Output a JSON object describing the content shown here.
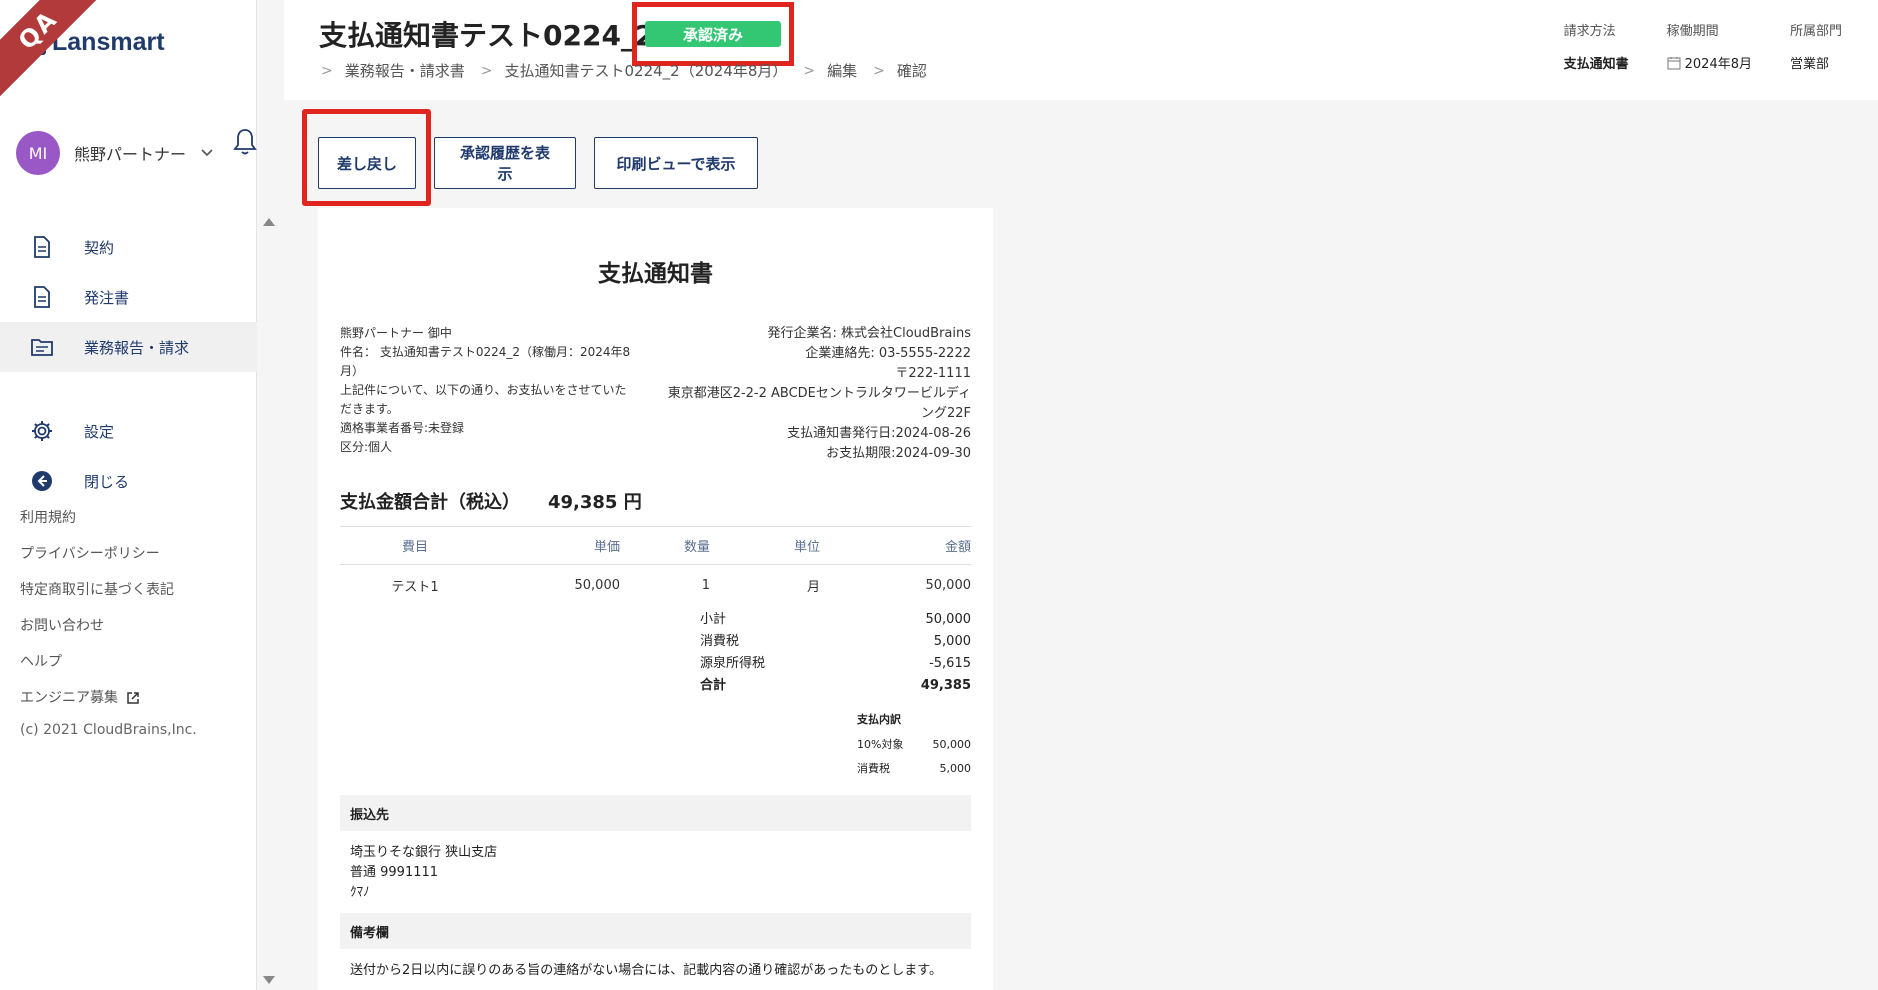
{
  "ribbon": "QA",
  "logo": {
    "text": "Lansmart"
  },
  "user": {
    "initials": "MI",
    "name": "熊野パートナー",
    "avatar_color": "#9a57c6"
  },
  "nav": {
    "contract": "契約",
    "order": "発注書",
    "report": "業務報告・請求",
    "settings": "設定",
    "close": "閉じる"
  },
  "links": {
    "terms": "利用規約",
    "privacy": "プライバシーポリシー",
    "commerce": "特定商取引に基づく表記",
    "contact": "お問い合わせ",
    "help": "ヘルプ",
    "engineer": "エンジニア募集",
    "copyright": "(c) 2021 CloudBrains,Inc."
  },
  "header": {
    "title": "支払通知書テスト0224_2",
    "status": "承認済み",
    "breadcrumb": [
      "業務報告・請求書",
      "支払通知書テスト0224_2（2024年8月）",
      "編集",
      "確認"
    ],
    "meta": {
      "method_label": "請求方法",
      "method_value": "支払通知書",
      "period_label": "稼働期間",
      "period_value": "2024年8月",
      "dept_label": "所属部門",
      "dept_value": "営業部"
    }
  },
  "actions": {
    "return": "差し戻し",
    "history": "承認履歴を表示",
    "print": "印刷ビューで表示"
  },
  "doc": {
    "title": "支払通知書",
    "left": [
      "熊野パートナー 御中",
      "件名： 支払通知書テスト0224_2（稼働月：2024年8月）",
      "上記件について、以下の通り、お支払いをさせていただきます。",
      "適格事業者番号:未登録",
      "区分:個人"
    ],
    "right": [
      "発行企業名: 株式会社CloudBrains",
      "企業連絡先: 03-5555-2222",
      "〒222-1111",
      "東京都港区2-2-2 ABCDEセントラルタワービルディング22F",
      "支払通知書発行日:2024-08-26",
      "お支払期限:2024-09-30"
    ],
    "total_label": "支払金額合計（税込）",
    "total_value": "49,385 円",
    "columns": [
      "費目",
      "単価",
      "数量",
      "単位",
      "金額"
    ],
    "rows": [
      {
        "item": "テスト1",
        "price": "50,000",
        "qty": "1",
        "unit": "月",
        "amount": "50,000"
      }
    ],
    "sums": [
      {
        "label": "小計",
        "value": "50,000"
      },
      {
        "label": "消費税",
        "value": "5,000"
      },
      {
        "label": "源泉所得税",
        "value": "-5,615"
      },
      {
        "label": "合計",
        "value": "49,385"
      }
    ],
    "breakdown": {
      "title": "支払内訳",
      "rows": [
        {
          "label": "10%対象",
          "value": "50,000"
        },
        {
          "label": "消費税",
          "value": "5,000"
        }
      ]
    },
    "bank_head": "振込先",
    "bank": [
      "埼玉りそな銀行 狭山支店",
      "普通 9991111",
      "ｸﾏﾉ"
    ],
    "note_head": "備考欄",
    "note": "送付から2日以内に誤りのある旨の連絡がない場合には、記載内容の通り確認があったものとします。"
  }
}
